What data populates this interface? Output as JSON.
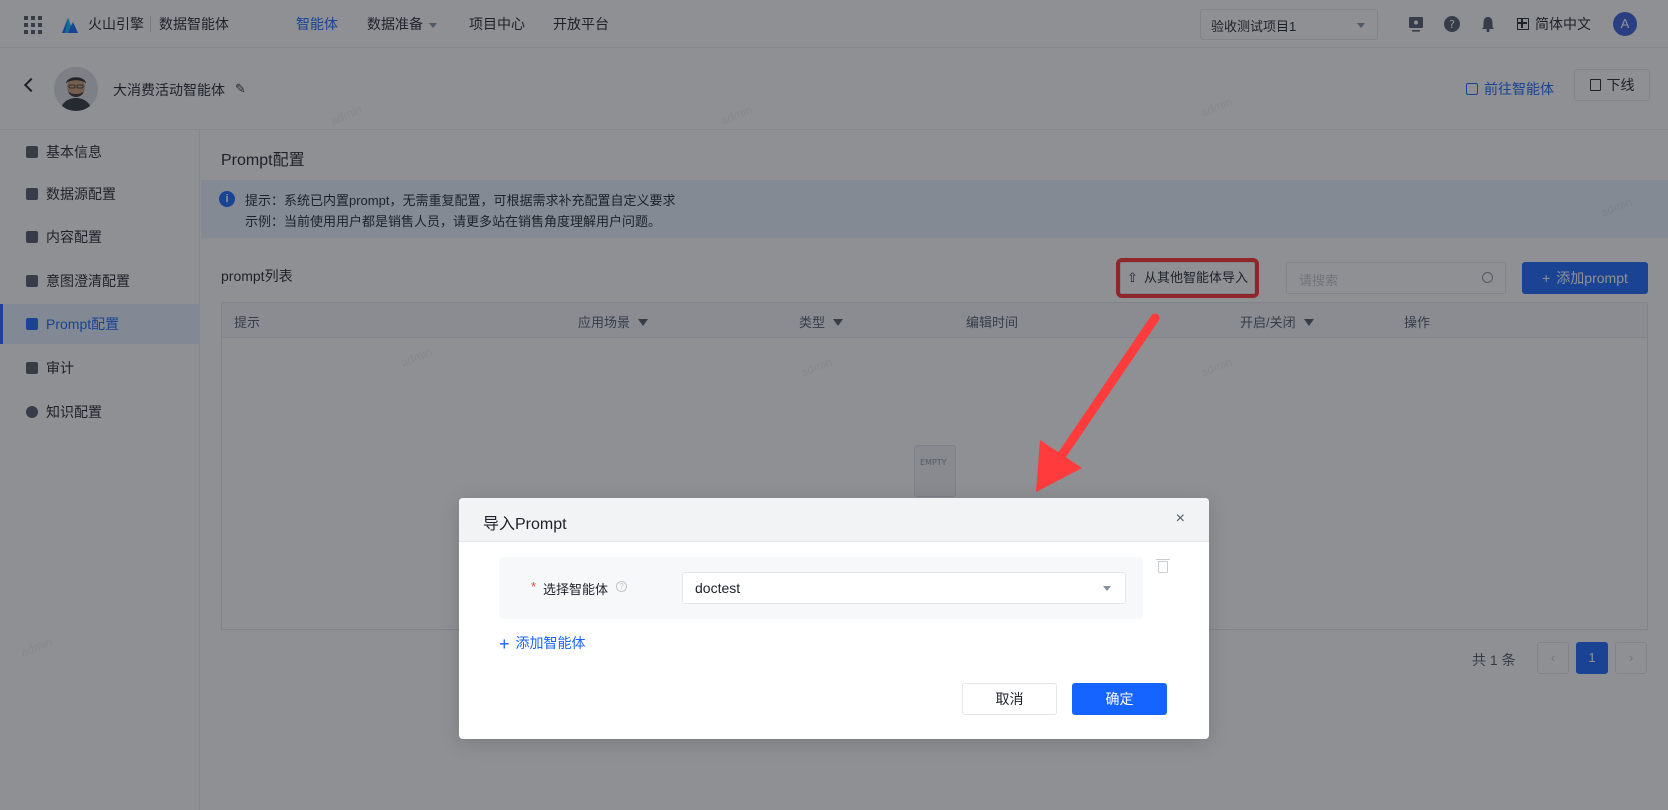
{
  "topbar": {
    "brand": "火山引擎",
    "product": "数据智能体",
    "nav": [
      {
        "label": "智能体",
        "active": true
      },
      {
        "label": "数据准备",
        "dropdown": true
      },
      {
        "label": "项目中心"
      },
      {
        "label": "开放平台"
      }
    ],
    "project": "验收测试项目1",
    "language": "简体中文",
    "user_initial": "A",
    "icons": [
      "apps-grid-icon",
      "volcano-logo-icon",
      "monitor-icon",
      "help-icon",
      "bell-icon",
      "language-icon"
    ]
  },
  "agent": {
    "name": "大消费活动智能体",
    "goto_label": "前往智能体",
    "offline_label": "下线"
  },
  "sidebar": {
    "items": [
      {
        "label": "基本信息"
      },
      {
        "label": "数据源配置"
      },
      {
        "label": "内容配置"
      },
      {
        "label": "意图澄清配置"
      },
      {
        "label": "Prompt配置",
        "active": true
      },
      {
        "label": "审计"
      },
      {
        "label": "知识配置"
      }
    ]
  },
  "main": {
    "section_title": "Prompt配置",
    "alert_line1": "提示：系统已内置prompt，无需重复配置，可根据需求补充配置自定义要求",
    "alert_line2": "示例：当前使用用户都是销售人员，请更多站在销售角度理解用户问题。",
    "list_title": "prompt列表",
    "import_label": "从其他智能体导入",
    "search_placeholder": "请搜索",
    "add_label": "添加prompt",
    "columns": [
      "提示",
      "应用场景",
      "类型",
      "编辑时间",
      "开启/关闭",
      "操作"
    ],
    "empty_text": "EMPTY",
    "pagination": {
      "total_text": "共 1 条",
      "current_page": "1",
      "prev": "‹",
      "next": "›"
    }
  },
  "modal": {
    "title": "导入Prompt",
    "close": "×",
    "field_required": "*",
    "field_label": "选择智能体",
    "field_help": "?",
    "field_value": "doctest",
    "add_agent_label": "添加智能体",
    "add_agent_plus": "+",
    "cancel_label": "取消",
    "ok_label": "确定"
  },
  "watermark": "admin",
  "colors": {
    "primary": "#1664ff",
    "highlight": "#ff2a2a",
    "mask": "rgba(29,33,41,0.5)"
  }
}
